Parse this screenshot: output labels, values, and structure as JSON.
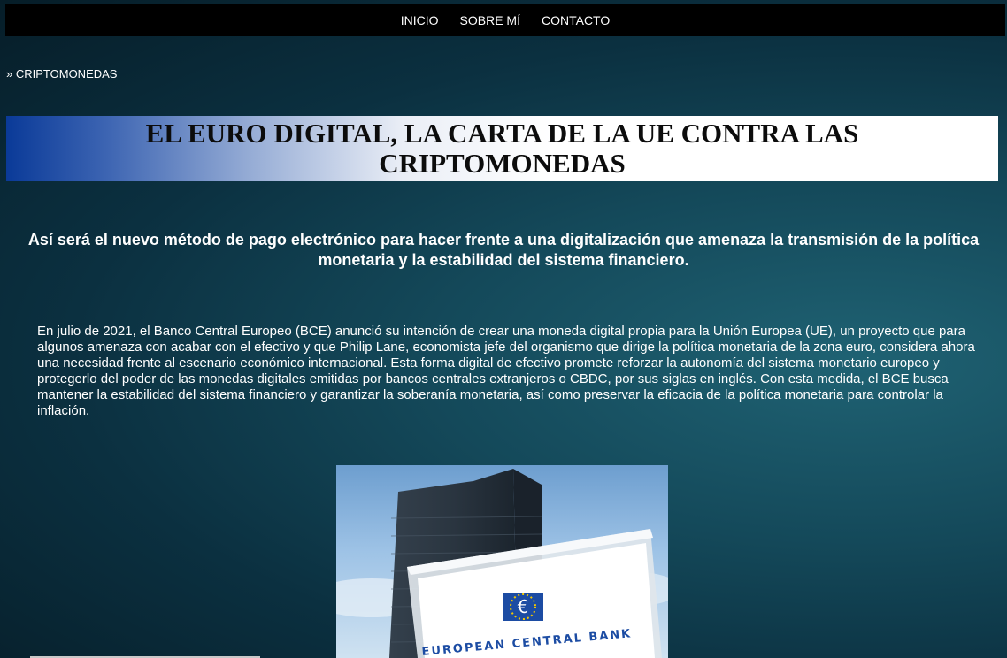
{
  "nav": {
    "items": [
      {
        "label": "INICIO"
      },
      {
        "label": "SOBRE MÍ"
      },
      {
        "label": "CONTACTO"
      }
    ]
  },
  "breadcrumb": {
    "separator": "»",
    "label": "CRIPTOMONEDAS"
  },
  "article": {
    "title": "EL EURO DIGITAL, LA CARTA DE LA UE CONTRA LAS CRIPTOMONEDAS",
    "subtitle": "Así será el nuevo método de pago electrónico para hacer frente a una digitalización que amenaza la transmisión de la política monetaria y la estabilidad del sistema financiero.",
    "paragraph": "En julio de 2021, el Banco Central Europeo (BCE) anunció su intención de crear una moneda digital propia para la Unión Europea (UE), un proyecto que para algunos amenaza con acabar con el efectivo y que Philip Lane, economista jefe del organismo que dirige la política monetaria de la zona euro, considera ahora una necesidad frente al escenario económico internacional. Esta forma digital de efectivo promete reforzar la autonomía del sistema monetario europeo y protegerlo del poder de las monedas digitales emitidas por bancos centrales extranjeros o CBDC, por sus siglas en inglés. Con esta medida, el BCE busca mantener la estabilidad del sistema financiero y garantizar la soberanía monetaria, así como preservar la eficacia de la política monetaria para controlar la inflación.",
    "image": {
      "sign_text": "EUROPEAN CENTRAL BANK",
      "logo_symbol": "€"
    }
  }
}
